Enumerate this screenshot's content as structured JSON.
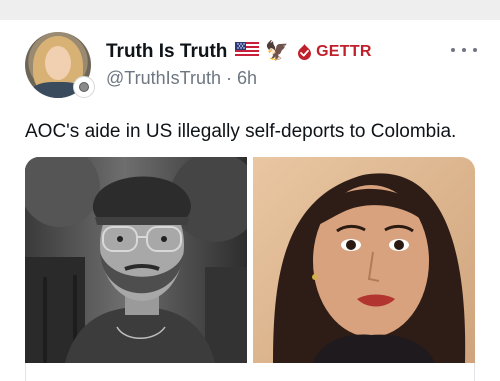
{
  "post": {
    "author": {
      "display_name": "Truth Is Truth",
      "handle": "@TruthIsTruth",
      "time_ago": "6h",
      "separator": "·",
      "badges": {
        "flag_icon": "us-flag-icon",
        "eagle_emoji": "🦅",
        "platform_icon": "gettr-logo-icon",
        "platform_label": "GETTR"
      }
    },
    "text": "AOC's aide in US illegally self-deports to Colombia.",
    "media": {
      "images": [
        {
          "name": "bearded-man-photo",
          "style": "black-and-white portrait"
        },
        {
          "name": "woman-portrait-photo",
          "style": "color portrait"
        }
      ]
    }
  },
  "colors": {
    "text": "#0f1419",
    "secondary_text": "#6e7781",
    "gettr_red": "#c0202c",
    "top_bar": "#eeeeee"
  }
}
